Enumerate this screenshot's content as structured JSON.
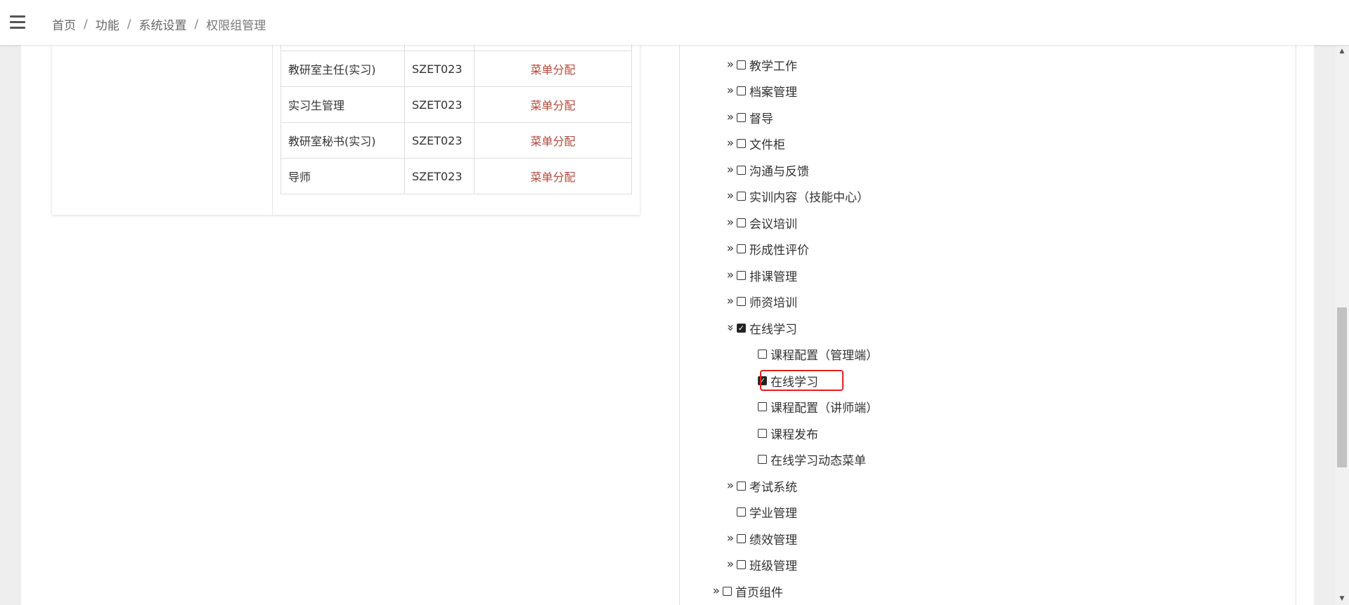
{
  "breadcrumb": {
    "items": [
      "首页",
      "功能",
      "系统设置",
      "权限组管理"
    ],
    "separator": "/"
  },
  "roles": {
    "rows": [
      {
        "name": "教研室主任(实习)",
        "code": "SZET023",
        "action": "菜单分配"
      },
      {
        "name": "实习生管理",
        "code": "SZET023",
        "action": "菜单分配"
      },
      {
        "name": "教研室秘书(实习)",
        "code": "SZET023",
        "action": "菜单分配"
      },
      {
        "name": "导师",
        "code": "SZET023",
        "action": "菜单分配"
      }
    ]
  },
  "tree": {
    "nodes": [
      {
        "label": "教学工作",
        "checked": false,
        "arrow": "»"
      },
      {
        "label": "档案管理",
        "checked": false,
        "arrow": "»"
      },
      {
        "label": "督导",
        "checked": false,
        "arrow": "»"
      },
      {
        "label": "文件柜",
        "checked": false,
        "arrow": "»"
      },
      {
        "label": "沟通与反馈",
        "checked": false,
        "arrow": "»"
      },
      {
        "label": "实训内容（技能中心）",
        "checked": false,
        "arrow": "»"
      },
      {
        "label": "会议培训",
        "checked": false,
        "arrow": "»"
      },
      {
        "label": "形成性评价",
        "checked": false,
        "arrow": "»"
      },
      {
        "label": "排课管理",
        "checked": false,
        "arrow": "»"
      },
      {
        "label": "师资培训",
        "checked": false,
        "arrow": "»"
      },
      {
        "label": "在线学习",
        "checked": true,
        "arrow": "»",
        "expanded": true
      },
      {
        "label": "课程配置（管理端）",
        "checked": false
      },
      {
        "label": "在线学习",
        "checked": true,
        "highlighted": true
      },
      {
        "label": "课程配置（讲师端）",
        "checked": false
      },
      {
        "label": "课程发布",
        "checked": false
      },
      {
        "label": "在线学习动态菜单",
        "checked": false
      },
      {
        "label": "考试系统",
        "checked": false,
        "arrow": "»"
      },
      {
        "label": "学业管理",
        "checked": false
      },
      {
        "label": "绩效管理",
        "checked": false,
        "arrow": "»"
      },
      {
        "label": "班级管理",
        "checked": false,
        "arrow": "»"
      },
      {
        "label": "首页组件",
        "checked": false,
        "arrow": "»"
      }
    ]
  },
  "colors": {
    "accent_link": "#b04a3d",
    "highlight_border": "#e0201e"
  }
}
